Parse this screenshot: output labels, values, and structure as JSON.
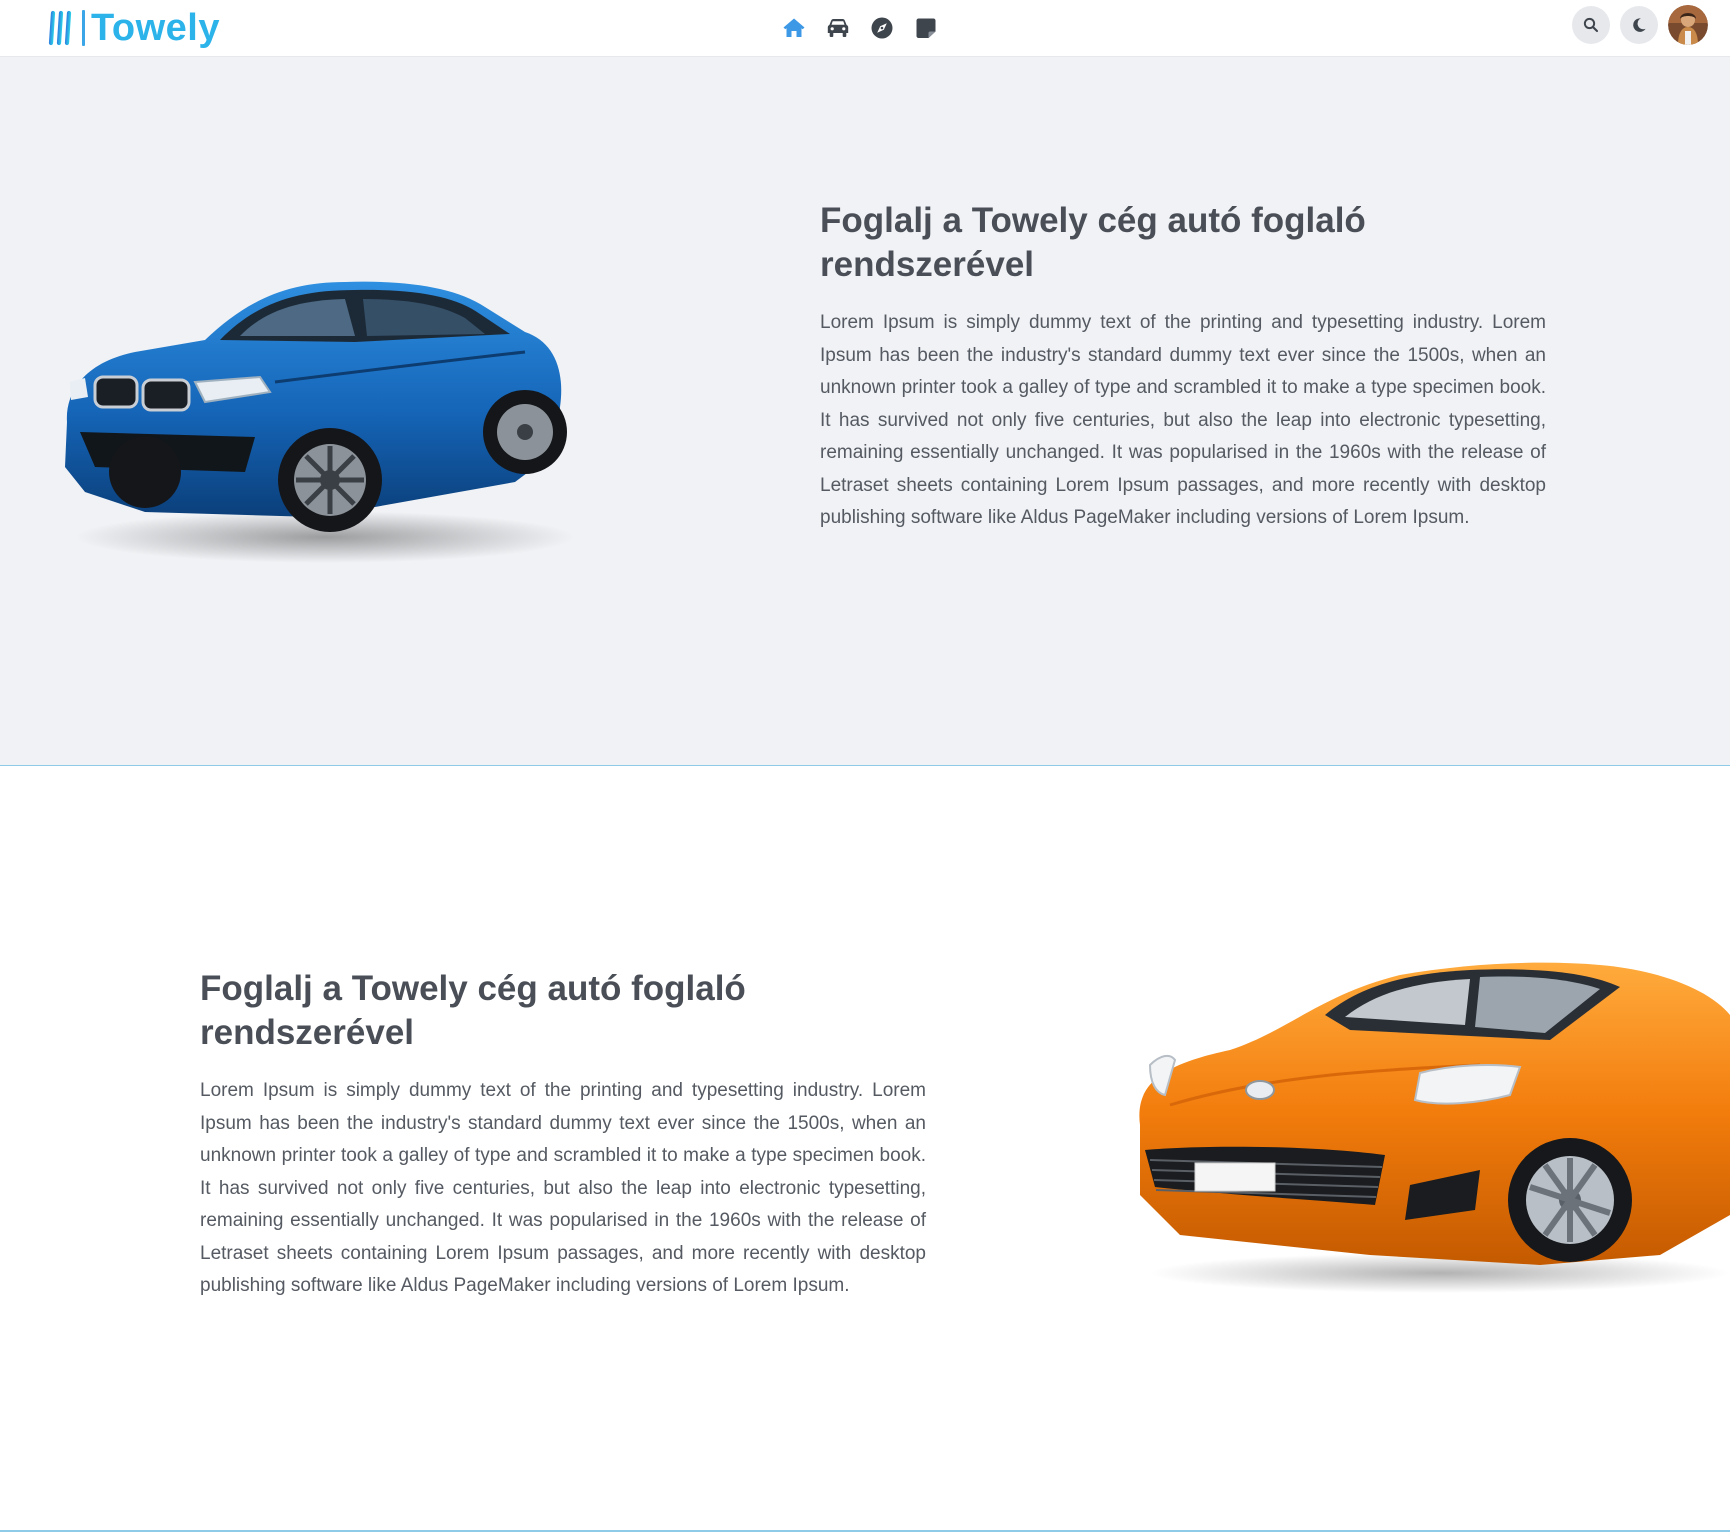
{
  "app": {
    "brand_name": "Towely",
    "brand_color": "#2bb3ea",
    "accent_color": "#3d98e6"
  },
  "header": {
    "nav": [
      {
        "icon": "home-icon",
        "active": true
      },
      {
        "icon": "car-icon",
        "active": false
      },
      {
        "icon": "compass-icon",
        "active": false
      },
      {
        "icon": "sticky-note-icon",
        "active": false
      }
    ],
    "actions": [
      {
        "icon": "search-icon"
      },
      {
        "icon": "moon-icon"
      },
      {
        "icon": "avatar"
      }
    ]
  },
  "sections": [
    {
      "heading": "Foglalj a Towely cég autó foglaló rendszerével",
      "body": "Lorem Ipsum is simply dummy text of the printing and typesetting industry. Lorem Ipsum has been the industry's standard dummy text ever since the 1500s, when an unknown printer took a galley of type and scrambled it to make a type specimen book. It has survived not only five centuries, but also the leap into electronic typesetting, remaining essentially unchanged. It was popularised in the 1960s with the release of Letraset sheets containing Lorem Ipsum passages, and more recently with desktop publishing software like Aldus PageMaker including versions of Lorem Ipsum.",
      "image": "blue-suv-image"
    },
    {
      "heading": "Foglalj a Towely cég autó foglaló rendszerével",
      "body": "Lorem Ipsum is simply dummy text of the printing and typesetting industry. Lorem Ipsum has been the industry's standard dummy text ever since the 1500s, when an unknown printer took a galley of type and scrambled it to make a type specimen book. It has survived not only five centuries, but also the leap into electronic typesetting, remaining essentially unchanged. It was popularised in the 1960s with the release of Letraset sheets containing Lorem Ipsum passages, and more recently with desktop publishing software like Aldus PageMaker including versions of Lorem Ipsum.",
      "image": "orange-sports-car-image"
    }
  ]
}
